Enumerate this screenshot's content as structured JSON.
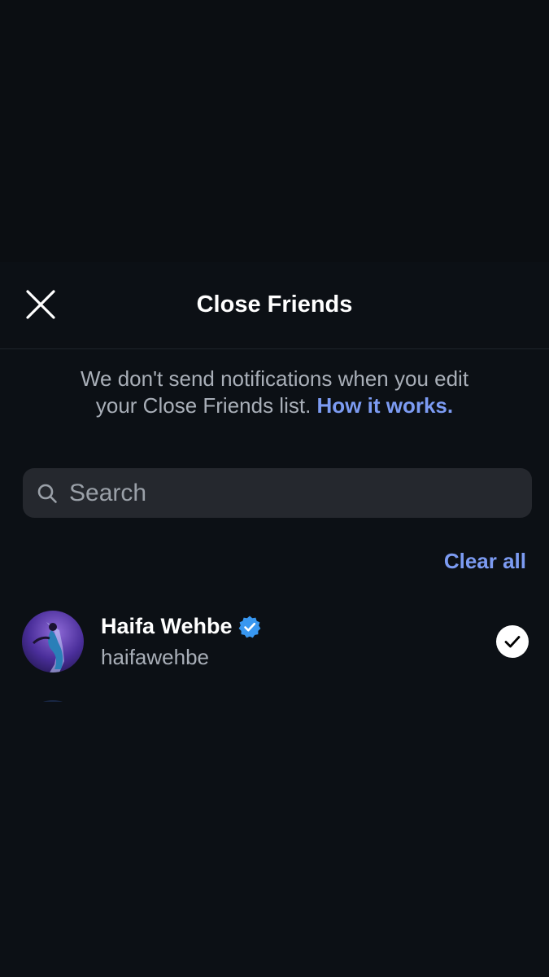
{
  "header": {
    "title": "Close Friends",
    "close_icon": "close-icon"
  },
  "notice": {
    "text": "We don't send notifications when you edit your Close Friends list.",
    "link": "How it works."
  },
  "search": {
    "placeholder": "Search",
    "icon": "search-icon"
  },
  "clear_all_label": "Clear all",
  "friends": [
    {
      "name": "Haifa Wehbe",
      "username": "haifawehbe",
      "verified": true,
      "selected": true
    }
  ],
  "colors": {
    "background": "#0b0e12",
    "accent_link": "#7c9bf2",
    "verified_badge": "#3897f0",
    "search_bg": "#25282e"
  }
}
